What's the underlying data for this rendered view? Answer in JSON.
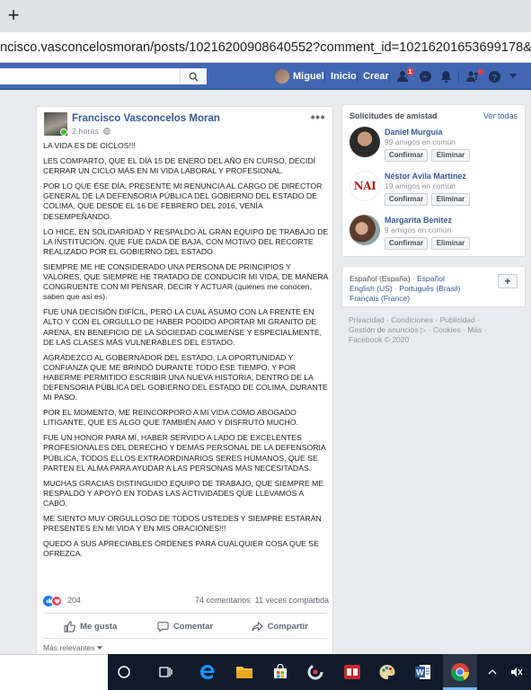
{
  "browser": {
    "newtab_glyph": "+",
    "url": "ncisco.vasconcelosmoran/posts/10216200908640552?comment_id=10216201653699178&notif_i"
  },
  "fb_nav": {
    "user_name": "Miguel",
    "home_label": "Inicio",
    "create_label": "Crear",
    "friend_badge": "1"
  },
  "post": {
    "author": "Francisco Vasconcelos Moran",
    "time": "2 horas",
    "paragraphs": [
      "LA VIDA ES DE CICLOS!!!",
      "LES COMPARTO, QUE EL DÍA 15 DE ENERO DEL AÑO EN CURSO, DECIDÍ CERRAR UN CICLO MÁS EN MI VIDA LABORAL Y PROFESIONAL.",
      "POR LO QUE ÉSE DÍA, PRESENTE MI RENUNCIA AL CARGO DE DIRECTOR GENERAL DE LA DEFENSORIA PÚBLICA DEL GOBIERNO DEL ESTADO DE COLIMA, QUE DESDE EL 16 DE FEBRERO DEL 2016, VENÍA DESEMPEÑANDO.",
      "LO HICE, EN SOLIDARIDAD Y RESPALDO AL GRAN EQUIPO DE TRABAJO DE LA INSTITUCIÓN, QUE FUE DADA DE BAJA, CON MOTIVO DEL RECORTE REALIZADO POR EL GOBIERNO DEL ESTADO.",
      "SIEMPRE ME HE CONSIDERADO UNA PERSONA DE PRINCIPIOS Y VALORES, QUE SIEMPRE HE TRATADO DE CONDUCIR MI VIDA, DE MANERA CONGRUENTE CON MI PENSAR, DECIR Y ACTUAR (quienes me conocen, saben que así es).",
      "FUE UNA DECISIÓN DIFÍCIL, PERO LA CUAL ASUMO CON LA FRENTE EN ALTO Y CON EL ORGULLO DE HABER PODIDO APORTAR MI GRANITO DE ARENA, EN BENEFICIO DE LA SOCIEDAD COLIMENSE Y ESPECIALMENTE, DE LAS CLASES MÁS VULNERABLES DEL ESTADO.",
      "AGRADEZCO AL GOBERNADOR DEL ESTADO, LA OPORTUNIDAD Y CONFIANZA QUE ME BRINDÓ DURANTE TODO ÉSE TIEMPO, Y POR HABERME PERMITIDO ESCRIBIR UNA NUEVA HISTORIA, DENTRO DE LA DEFENSORIA PÚBLICA DEL GOBIERNO DEL ESTADO DE COLIMA, DURANTE MI PASO.",
      "POR EL MOMENTO, ME REINCORPORO A MI VIDA COMO ABOGADO LITIGANTE, QUE ES ALGO QUE TAMBIÉN AMO Y DISFRUTO MUCHO.",
      "FUE UN HONOR PARA MÍ, HABER SERVIDO A LADO DE EXCELENTES PROFESIONALES DEL DERECHO Y DEMÁS PERSONAL DE LA DEFENSORIA PÚBLICA, TODOS ELLOS EXTRAORDINARIOS SERES HUMANOS, QUE SE PARTEN EL ALMA PARA AYUDAR A LAS PERSONAS MÁS NECESITADAS.",
      "MUCHAS GRACIAS DISTINGUIDO EQUIPO DE TRABAJO, QUE SIEMPRE ME RESPALDÓ Y APOYÓ EN TODAS LAS ACTIVIDADES QUE LLEVAMOS A CABO.",
      "ME SIENTO MUY ORGULLOSO DE TODOS USTEDES Y SIEMPRE ESTARÁN PRESENTES EN MI VIDA Y EN MIS ORACIONES!!!",
      "QUEDO A SUS APRECIABLES ÓRDENES PARA CUALQUIER COSA QUE SE OFREZCA."
    ],
    "reaction_count": "204",
    "comments": "74 comentarios",
    "shares": "11 veces compartida",
    "like_label": "Me gusta",
    "comment_label": "Comentar",
    "share_label": "Compartir",
    "sort_label": "Más relevantes"
  },
  "friend_requests": {
    "title": "Solicitudes de amistad",
    "see_all": "Ver todas",
    "confirm_label": "Confirmar",
    "delete_label": "Eliminar",
    "items": [
      {
        "name": "Daniel Murguía",
        "mutual": "99 amigos en común"
      },
      {
        "name": "Néstor Avila Martínez",
        "mutual": "19 amigos en común",
        "photo_text": "NAI"
      },
      {
        "name": "Margarita Benitez",
        "mutual": "9 amigos en común"
      }
    ]
  },
  "languages": {
    "current": "Español (España)",
    "sep": " · ",
    "links": [
      "Español",
      "English (US)",
      "Português (Brasil)",
      "Français (France)"
    ],
    "add_glyph": "+"
  },
  "footer": {
    "line1": "Privacidad · Condiciones · Publicidad ·",
    "line2": "Gestión de anuncios ▷ · Cookies · Más ·",
    "line3": "Facebook © 2020"
  },
  "taskbar": {
    "tray_text": "^ ¶x"
  },
  "colors": {
    "fb_blue": "#4267b2",
    "link": "#385898",
    "taskbar": "#101a2b"
  }
}
